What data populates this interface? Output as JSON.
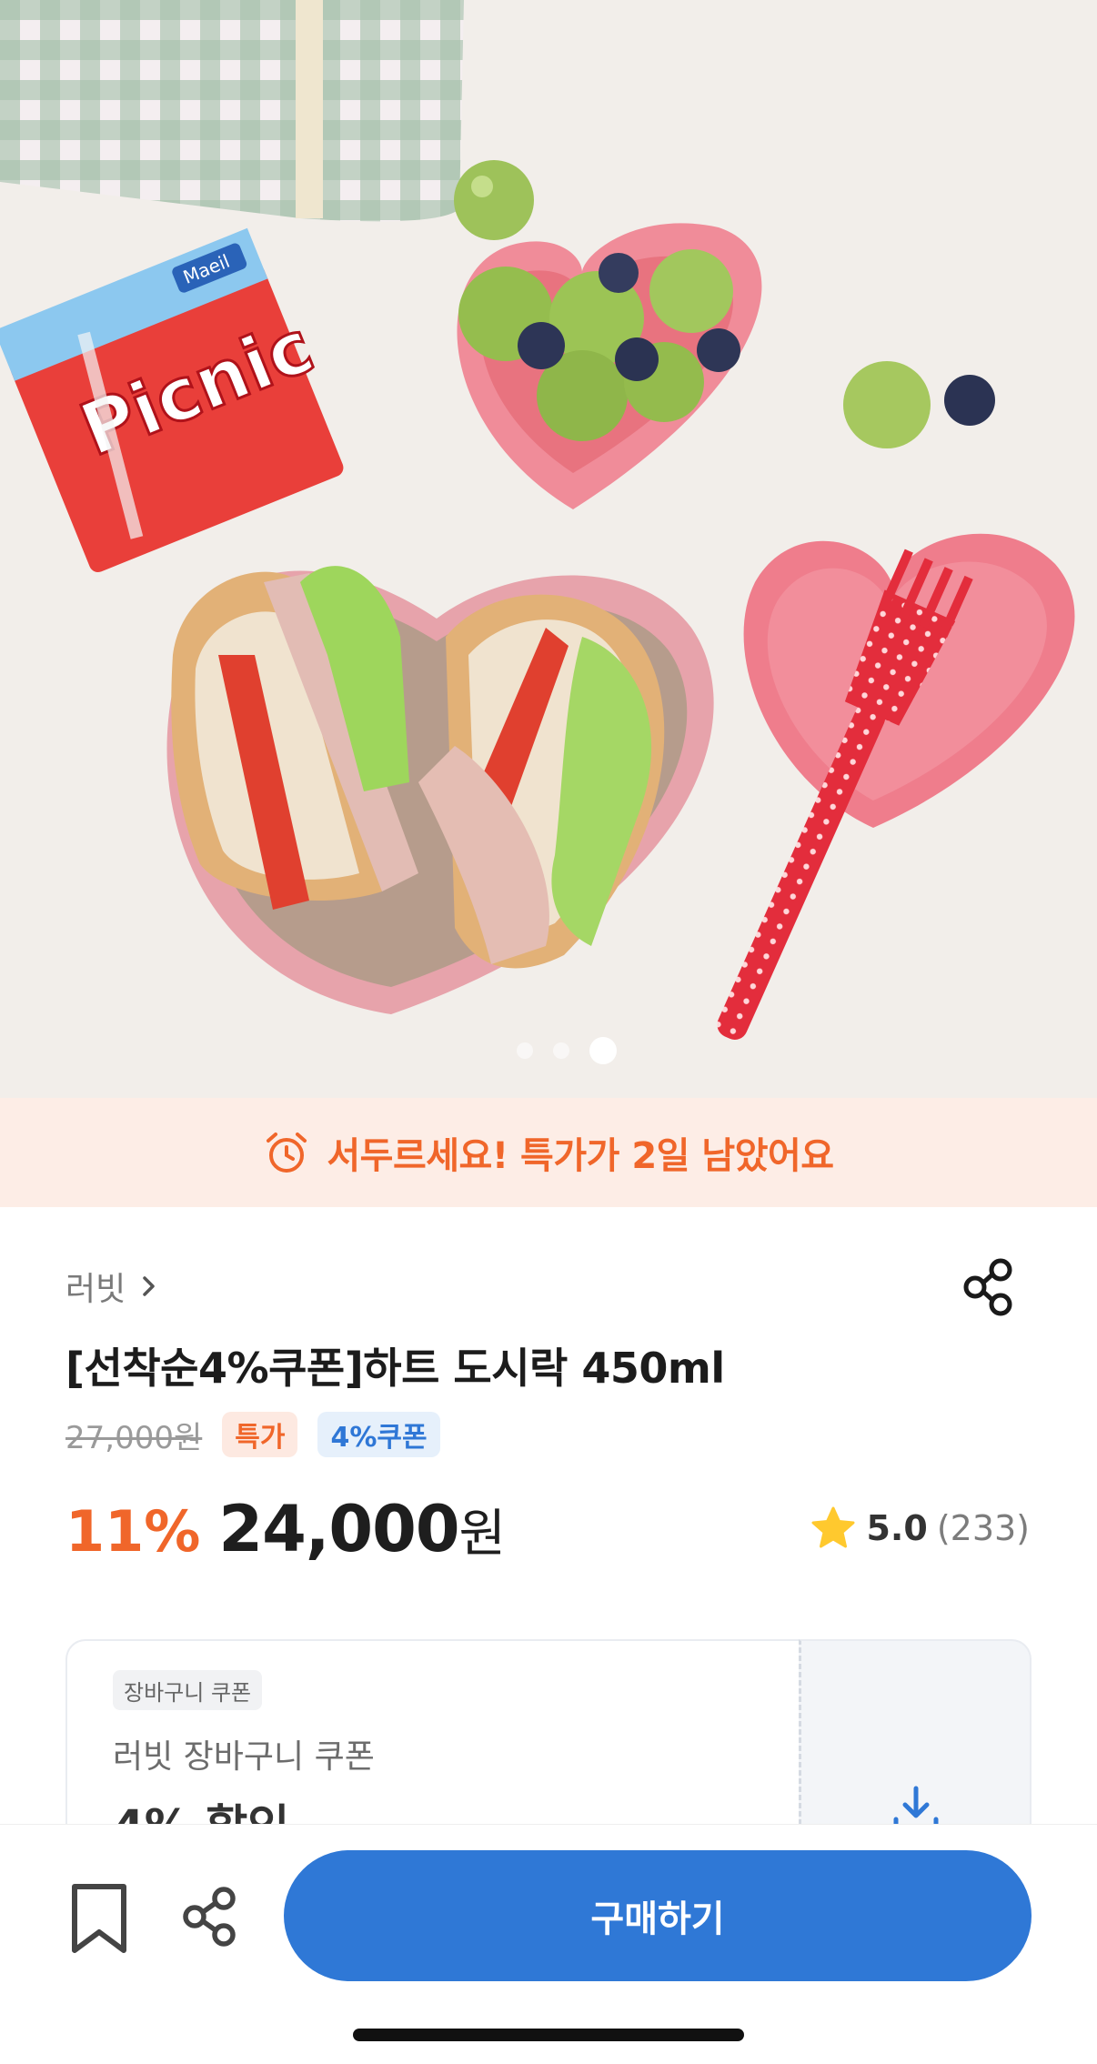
{
  "gallery": {
    "current_index": 3,
    "total": 3,
    "carton_text": "Picnic",
    "carton_brand": "Maeil"
  },
  "deal_banner": {
    "text": "서두르세요! 특가가 2일 남았어요",
    "icon": "alarm-clock-icon",
    "color": "#f0662a"
  },
  "product": {
    "brand": "러빗",
    "title": "[선착순4%쿠폰]하트 도시락 450ml",
    "original_price": "27,000원",
    "tags": [
      "특가",
      "4%쿠폰"
    ],
    "discount": "11%",
    "price": "24,000",
    "currency": "원",
    "rating": "5.0",
    "review_count": "(233)"
  },
  "coupon": {
    "chip": "장바구니 쿠폰",
    "name": "러빗 장바구니 쿠폰",
    "value": "4% 할인",
    "icon": "download-icon"
  },
  "bottom_bar": {
    "buy_label": "구매하기",
    "accent": "#2f78d6"
  }
}
